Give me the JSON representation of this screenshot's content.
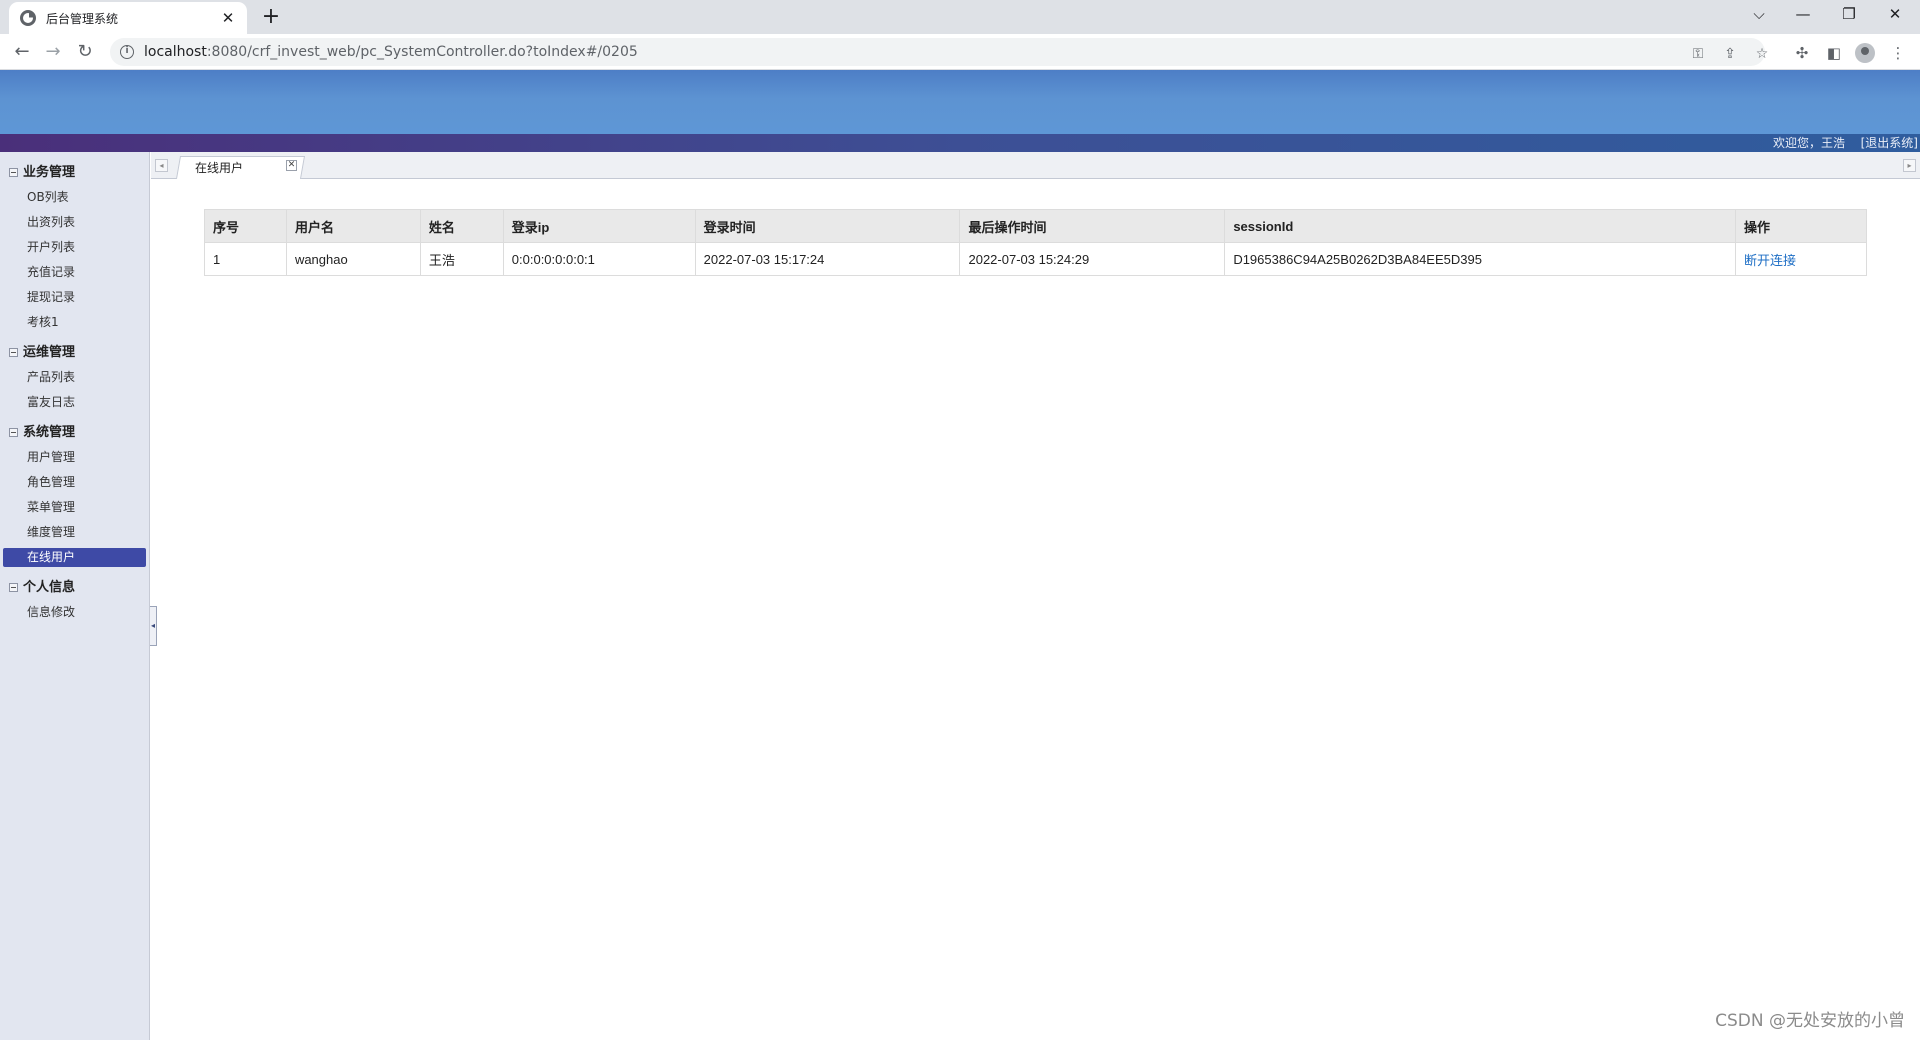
{
  "browser": {
    "tab_title": "后台管理系统",
    "tab_close": "✕",
    "new_tab": "+",
    "url_host": "localhost",
    "url_path": ":8080/crf_invest_web/pc_SystemController.do?toIndex#/0205",
    "window_controls": {
      "minimize": "—",
      "restore": "❐",
      "close": "✕",
      "dropdown": "⌵"
    }
  },
  "header": {
    "welcome": "欢迎您，王浩",
    "logout": "[退出系统]"
  },
  "sidebar": {
    "groups": [
      {
        "title": "业务管理",
        "items": [
          "OB列表",
          "出资列表",
          "开户列表",
          "充值记录",
          "提现记录",
          "考核1"
        ]
      },
      {
        "title": "运维管理",
        "items": [
          "产品列表",
          "富友日志"
        ]
      },
      {
        "title": "系统管理",
        "items": [
          "用户管理",
          "角色管理",
          "菜单管理",
          "维度管理",
          "在线用户"
        ]
      },
      {
        "title": "个人信息",
        "items": [
          "信息修改"
        ]
      }
    ],
    "active_item": "在线用户"
  },
  "content_tab": {
    "label": "在线用户",
    "close": "✕"
  },
  "table": {
    "columns": [
      "序号",
      "用户名",
      "姓名",
      "登录ip",
      "登录时间",
      "最后操作时间",
      "sessionId",
      "操作"
    ],
    "rows": [
      [
        "1",
        "wanghao",
        "王浩",
        "0:0:0:0:0:0:0:1",
        "2022-07-03 15:17:24",
        "2022-07-03 15:24:29",
        "D1965386C94A25B0262D3BA84EE5D395",
        "断开连接"
      ]
    ]
  },
  "watermark": "CSDN @无处安放的小曾",
  "colors": {
    "header_blue": "#5d93d2",
    "welcome_bar": "#3d4f95",
    "sidebar_bg": "#e2e6f0",
    "active_menu": "#3e4aa6",
    "link_blue": "#1f6fc5"
  }
}
